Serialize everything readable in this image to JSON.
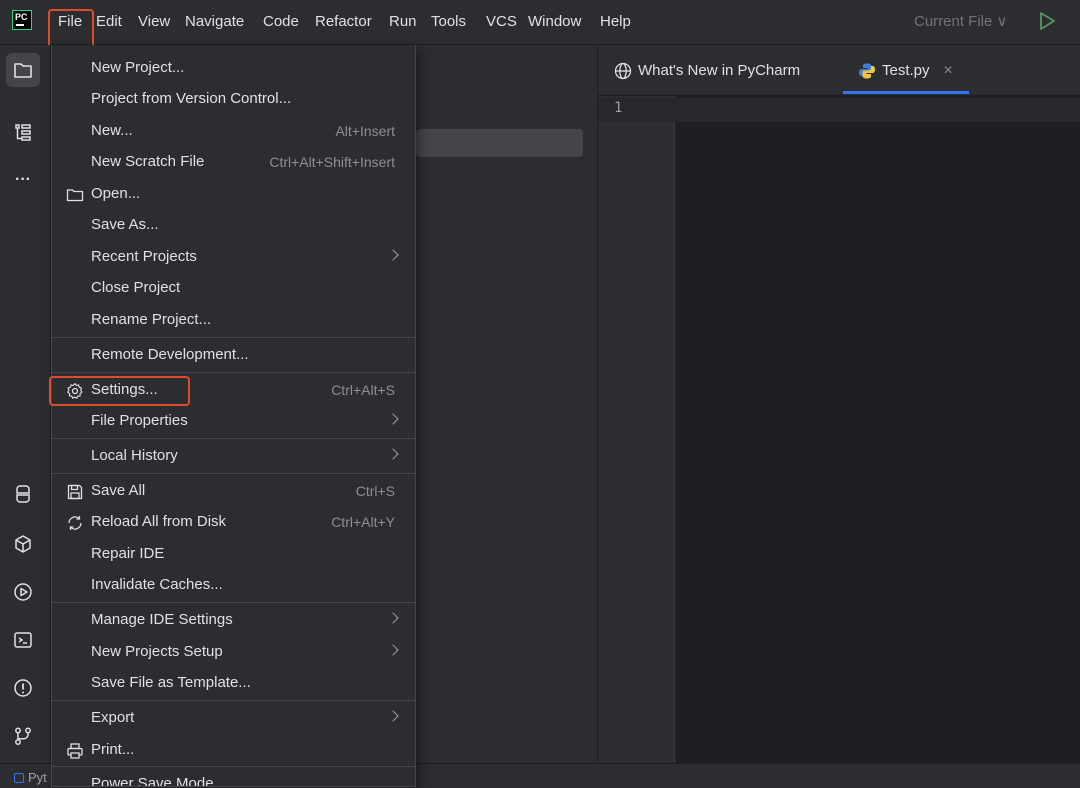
{
  "app": {
    "logo_text": "PC",
    "accent_color": "#3574f0",
    "annotation_color": "#e04b2b"
  },
  "menubar": {
    "items": [
      {
        "label": "File"
      },
      {
        "label": "Edit"
      },
      {
        "label": "View"
      },
      {
        "label": "Navigate"
      },
      {
        "label": "Code"
      },
      {
        "label": "Refactor"
      },
      {
        "label": "Run"
      },
      {
        "label": "Tools"
      },
      {
        "label": "VCS"
      },
      {
        "label": "Window"
      },
      {
        "label": "Help"
      }
    ],
    "run_config": "Current File ∨"
  },
  "left_toolbar": {
    "icons": [
      "folder-icon",
      "structure-icon",
      "more-icon",
      "python-console-icon",
      "python-packages-icon",
      "services-icon",
      "terminal-icon",
      "problems-icon",
      "git-icon"
    ],
    "more_glyph": "···"
  },
  "editor": {
    "tabs": [
      {
        "label": "What's New in PyCharm",
        "icon": "globe-icon"
      },
      {
        "label": "Test.py",
        "icon": "python-file-icon",
        "close": "×"
      }
    ],
    "line_numbers": [
      "1"
    ]
  },
  "status_bar": {
    "text": "Pyt"
  },
  "file_menu": {
    "items": [
      {
        "label": "New Project...",
        "shortcut": ""
      },
      {
        "label": "Project from Version Control...",
        "shortcut": ""
      },
      {
        "label": "New...",
        "shortcut": "Alt+Insert"
      },
      {
        "label": "New Scratch File",
        "shortcut": "Ctrl+Alt+Shift+Insert"
      },
      {
        "label": "Open...",
        "shortcut": "",
        "icon": "folder-open-icon"
      },
      {
        "label": "Save As...",
        "shortcut": ""
      },
      {
        "label": "Recent Projects",
        "submenu": true
      },
      {
        "label": "Close Project",
        "shortcut": ""
      },
      {
        "label": "Rename Project...",
        "shortcut": ""
      },
      {
        "label": "Remote Development...",
        "shortcut": ""
      },
      {
        "label": "Settings...",
        "shortcut": "Ctrl+Alt+S",
        "icon": "gear-icon"
      },
      {
        "label": "File Properties",
        "submenu": true
      },
      {
        "label": "Local History",
        "submenu": true
      },
      {
        "label": "Save All",
        "shortcut": "Ctrl+S",
        "icon": "save-icon"
      },
      {
        "label": "Reload All from Disk",
        "shortcut": "Ctrl+Alt+Y",
        "icon": "reload-icon"
      },
      {
        "label": "Repair IDE",
        "shortcut": ""
      },
      {
        "label": "Invalidate Caches...",
        "shortcut": ""
      },
      {
        "label": "Manage IDE Settings",
        "submenu": true
      },
      {
        "label": "New Projects Setup",
        "submenu": true
      },
      {
        "label": "Save File as Template...",
        "shortcut": ""
      },
      {
        "label": "Export",
        "submenu": true
      },
      {
        "label": "Print...",
        "shortcut": "",
        "icon": "print-icon"
      },
      {
        "label": "Power Save Mode",
        "shortcut": ""
      }
    ]
  }
}
